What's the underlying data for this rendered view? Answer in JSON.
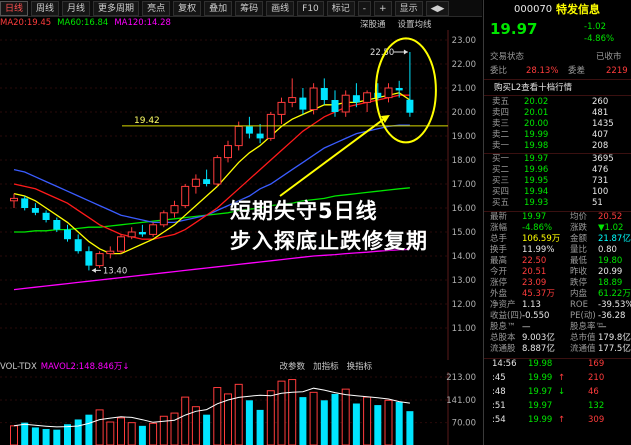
{
  "toolbar": {
    "tabs": [
      "日线",
      "周线",
      "月线",
      "更多周期"
    ],
    "buttons": [
      "亮点",
      "复权",
      "叠加",
      "筹码",
      "画线",
      "F10",
      "标记",
      "-",
      "+",
      "显示",
      "◀▶"
    ]
  },
  "ma_legend": [
    {
      "label": "MA20:19.45",
      "color": "#ff3c3c"
    },
    {
      "label": "MA60:16.84",
      "color": "#00e600"
    },
    {
      "label": "MA120:14.28",
      "color": "#ff00ff"
    }
  ],
  "chart_settings": [
    "深股通",
    "设置均线"
  ],
  "price_axis": [
    "23.00",
    "22.00",
    "21.00",
    "20.00",
    "19.00",
    "18.00",
    "17.00",
    "16.00",
    "15.00",
    "14.00",
    "13.00",
    "12.00",
    "11.00"
  ],
  "labels": {
    "high": "22.50",
    "low": "13.40",
    "support": "19.42"
  },
  "annotation": {
    "line1": "短期失守5日线",
    "line2": "步入探底止跌修复期"
  },
  "volume": {
    "header_left": "VOL-TDX",
    "header_value": "MAVOL2:148.846万",
    "header_arrow": "↓",
    "header_right": [
      "改参数",
      "加指标",
      "换指标"
    ],
    "axis": [
      "213.00",
      "141.00",
      "70.00"
    ]
  },
  "quote": {
    "code": "000070",
    "name": "特发信息",
    "price": "19.97",
    "change": "-1.02",
    "change_pct": "-4.86%",
    "status_label": "交易状态",
    "status_value": "已收市",
    "weibi_label": "委比",
    "weibi_value": "28.13%",
    "weicha_label": "委差",
    "weicha_value": "2219",
    "l2_link": "购买L2查看十档行情",
    "asks": [
      {
        "label": "卖五",
        "price": "20.02",
        "vol": "260"
      },
      {
        "label": "卖四",
        "price": "20.01",
        "vol": "481"
      },
      {
        "label": "卖三",
        "price": "20.00",
        "vol": "1435"
      },
      {
        "label": "卖二",
        "price": "19.99",
        "vol": "407"
      },
      {
        "label": "卖一",
        "price": "19.98",
        "vol": "208"
      }
    ],
    "bids": [
      {
        "label": "买一",
        "price": "19.97",
        "vol": "3695"
      },
      {
        "label": "买二",
        "price": "19.96",
        "vol": "476"
      },
      {
        "label": "买三",
        "price": "19.95",
        "vol": "731"
      },
      {
        "label": "买四",
        "price": "19.94",
        "vol": "100"
      },
      {
        "label": "买五",
        "price": "19.93",
        "vol": "51"
      }
    ],
    "stats": [
      {
        "l": "最新",
        "v": "19.97",
        "vc": "green",
        "l2": "均价",
        "v2": "20.52",
        "v2c": "red"
      },
      {
        "l": "涨幅",
        "v": "-4.86%",
        "vc": "green",
        "l2": "涨跌",
        "v2": "▼1.02",
        "v2c": "green"
      },
      {
        "l": "总手",
        "v": "106.59万",
        "vc": "yellow",
        "l2": "金额",
        "v2": "21.87亿",
        "v2c": "cyan"
      },
      {
        "l": "换手",
        "v": "11.99%",
        "vc": "white",
        "l2": "量比",
        "v2": "0.80",
        "v2c": "white"
      },
      {
        "l": "最高",
        "v": "22.50",
        "vc": "red",
        "l2": "最低",
        "v2": "19.80",
        "v2c": "green"
      },
      {
        "l": "今开",
        "v": "20.51",
        "vc": "red",
        "l2": "昨收",
        "v2": "20.99",
        "v2c": "white"
      },
      {
        "l": "涨停",
        "v": "23.09",
        "vc": "red",
        "l2": "跌停",
        "v2": "18.89",
        "v2c": "green"
      },
      {
        "l": "外盘",
        "v": "45.37万",
        "vc": "red",
        "l2": "内盘",
        "v2": "61.22万",
        "v2c": "green"
      },
      {
        "l": "净资产",
        "v": "1.13",
        "vc": "white",
        "l2": "ROE",
        "v2": "-39.53%",
        "v2c": "white"
      },
      {
        "l": "收益(四)",
        "v": "-0.550",
        "vc": "white",
        "l2": "PE(动)",
        "v2": "-36.28",
        "v2c": "white"
      },
      {
        "l": "股息™",
        "v": "—",
        "vc": "white",
        "l2": "股息率™",
        "v2": "—",
        "v2c": "white"
      },
      {
        "l": "总股本",
        "v": "9.003亿",
        "vc": "white",
        "l2": "总市值",
        "v2": "179.8亿",
        "v2c": "white"
      },
      {
        "l": "流通股",
        "v": "8.887亿",
        "vc": "white",
        "l2": "流通值",
        "v2": "177.5亿",
        "v2c": "white"
      }
    ],
    "ticks": [
      {
        "t": "14:56",
        "p": "19.98",
        "pc": "green",
        "arrow": "",
        "v": "169",
        "vc": "red"
      },
      {
        "t": ":45",
        "p": "19.99",
        "pc": "green",
        "arrow": "↑",
        "v": "210",
        "vc": "red"
      },
      {
        "t": ":48",
        "p": "19.97",
        "pc": "green",
        "arrow": "↓",
        "v": "46",
        "vc": "red"
      },
      {
        "t": ":51",
        "p": "19.97",
        "pc": "green",
        "arrow": "",
        "v": "132",
        "vc": "green"
      },
      {
        "t": ":54",
        "p": "19.99",
        "pc": "green",
        "arrow": "↑",
        "v": "309",
        "vc": "red"
      }
    ]
  }
}
